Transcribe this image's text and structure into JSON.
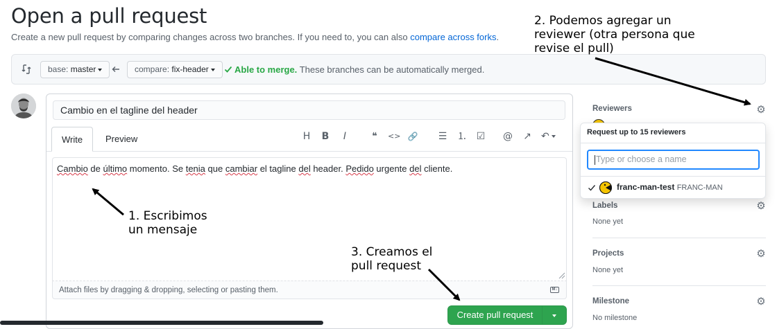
{
  "page": {
    "title": "Open a pull request",
    "subtitle_text": "Create a new pull request by comparing changes across two branches. If you need to, you can also ",
    "subtitle_link": "compare across forks",
    "subtitle_end": "."
  },
  "compare": {
    "base_label": "base:",
    "base_value": "master",
    "compare_label": "compare:",
    "compare_value": "fix-header",
    "merge_ok": "Able to merge.",
    "merge_text": "These branches can be automatically merged."
  },
  "form": {
    "title_value": "Cambio en el tagline del header",
    "tab_write": "Write",
    "tab_preview": "Preview",
    "body_words": [
      "Cambio",
      " de ",
      "último",
      " momento. Se ",
      "tenia",
      " que ",
      "cambiar",
      " el tagline ",
      "del",
      " header. ",
      "Pedido",
      " urgente ",
      "del",
      " cliente."
    ],
    "attach_hint": "Attach files by dragging & dropping, selecting or pasting them.",
    "markdown_badge": "M↓",
    "create_button": "Create pull request"
  },
  "toolbar": {
    "icons": [
      "heading-icon",
      "bold-icon",
      "italic-icon",
      "quote-icon",
      "code-icon",
      "link-icon",
      "unordered-list-icon",
      "ordered-list-icon",
      "task-list-icon",
      "mention-icon",
      "cross-reference-icon",
      "reply-icon"
    ],
    "glyphs": [
      "H",
      "B",
      "I",
      "❝",
      "<>",
      "🔗",
      "☰",
      "⒈",
      "☑",
      "@",
      "↗",
      "↶"
    ]
  },
  "sidebar": {
    "reviewers": "Reviewers",
    "labels": "Labels",
    "labels_value": "None yet",
    "projects": "Projects",
    "projects_value": "None yet",
    "milestone": "Milestone",
    "milestone_value": "No milestone"
  },
  "popover": {
    "header": "Request up to 15 reviewers",
    "placeholder": "Type or choose a name",
    "user_login": "franc-man-test",
    "user_name": "FRANC-MAN"
  },
  "annotations": {
    "note1": "1. Escribimos\nun mensaje",
    "note2": "2. Podemos agregar un\nreviewer (otra persona que\nrevise el pull)",
    "note3": "3. Creamos el\npull request"
  },
  "colors": {
    "link": "#0366d6",
    "merge_ok": "#28a745",
    "primary_button": "#2ea44f",
    "focus_ring": "#2188ff"
  }
}
